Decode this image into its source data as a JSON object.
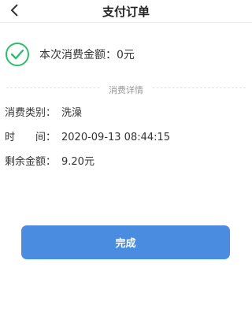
{
  "nav": {
    "title": "支付订单",
    "back_icon": "chevron-left-icon"
  },
  "summary": {
    "icon": "check-circle-icon",
    "icon_color": "#2dbe6c",
    "text": "本次消费金额：0元"
  },
  "details": {
    "section_label": "消费详情",
    "rows": [
      {
        "label": "消费类别：",
        "value": "洗澡"
      },
      {
        "label": "时　　间：",
        "value": "2020-09-13 08:44:15"
      },
      {
        "label": "剩余金额：",
        "value": "9.20元"
      }
    ]
  },
  "actions": {
    "done_label": "完成",
    "button_color": "#4a8ce0"
  }
}
